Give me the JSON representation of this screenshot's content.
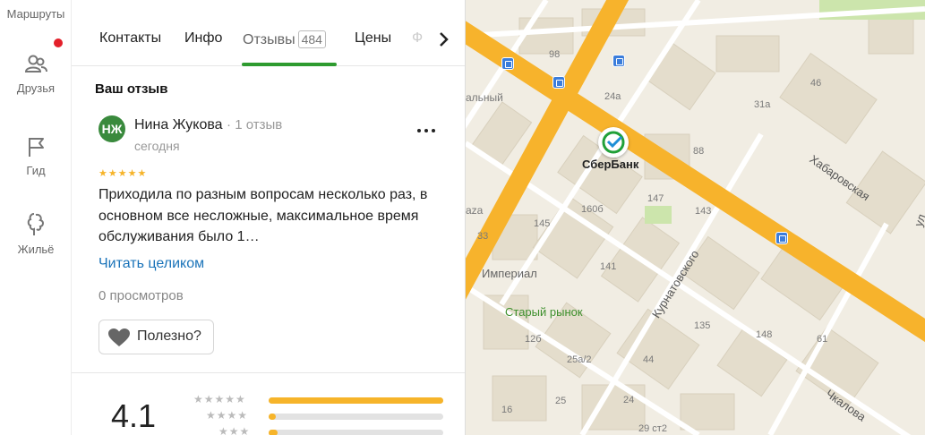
{
  "rail": {
    "routes_label": "Маршруты",
    "friends_label": "Друзья",
    "guide_label": "Гид",
    "housing_label": "Жильё"
  },
  "tabs": {
    "contacts": "Контакты",
    "info": "Инфо",
    "reviews": "Отзывы",
    "reviews_count": "484",
    "prices": "Цены",
    "photo": "Ф"
  },
  "my_review": {
    "section_title": "Ваш отзыв",
    "avatar_initials": "НЖ",
    "author": "Нина Жукова",
    "author_reviews": "1 отзыв",
    "date": "сегодня",
    "rating": 5,
    "text": "Приходила по разным вопросам несколько раз, в основном все несложные, максимальное время обслуживания было 1…",
    "read_more": "Читать целиком",
    "views": "0 просмотров",
    "helpful_label": "Полезно?"
  },
  "summary": {
    "average": "4.1",
    "distribution": [
      {
        "stars": 5,
        "fraction": 1.0
      },
      {
        "stars": 4,
        "fraction": 0.04
      },
      {
        "stars": 3,
        "fraction": 0.05
      }
    ]
  },
  "map": {
    "poi_name": "СберБанк",
    "streets": [
      "Хабаровская",
      "Курнатовского",
      "Чкалова"
    ],
    "places": [
      "Старый рынок",
      "Империал"
    ],
    "house_numbers": [
      "98",
      "24а",
      "46",
      "31а",
      "88",
      "147",
      "160б",
      "143",
      "145",
      "141",
      "135",
      "148",
      "61",
      "12б",
      "25а/2",
      "44",
      "25",
      "24",
      "29 ст2",
      "33",
      "16"
    ],
    "partial_labels": [
      "альный",
      "aza",
      "ул"
    ],
    "colors": {
      "major_road": "#f7b32c",
      "building": "#e3dccb",
      "park": "#c9e4a8",
      "sber_green": "#21a038"
    }
  }
}
